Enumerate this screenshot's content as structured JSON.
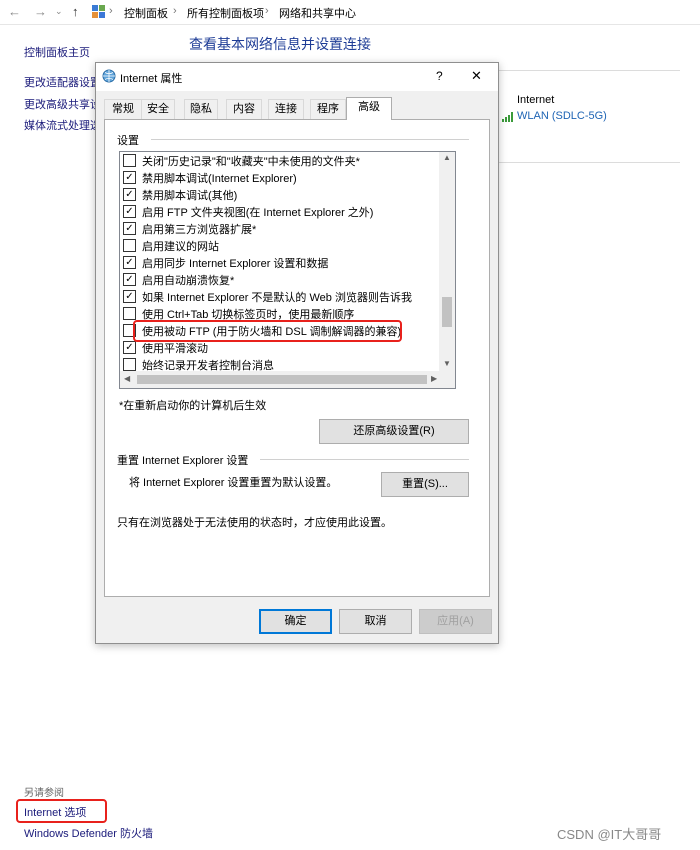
{
  "address_bar": {
    "crumbs": [
      "控制面板",
      "所有控制面板项",
      "网络和共享中心"
    ]
  },
  "control_panel": {
    "left_links": [
      "控制面板主页",
      "更改适配器设置",
      "更改高级共享设置",
      "媒体流式处理选项"
    ],
    "title": "查看基本网络信息并设置连接",
    "network_label": "Internet",
    "wlan_link": "WLAN (SDLC-5G)",
    "see_also": "另请参阅",
    "internet_options": "Internet 选项",
    "firewall": "Windows Defender 防火墙"
  },
  "dialog": {
    "title": "Internet 属性",
    "help": "?",
    "close": "✕",
    "tabs": [
      "常规",
      "安全",
      "隐私",
      "内容",
      "连接",
      "程序",
      "高级"
    ],
    "active_tab": "高级",
    "settings_label": "设置",
    "items": [
      {
        "label": "关闭\"历史记录\"和\"收藏夹\"中未使用的文件夹*",
        "checked": false
      },
      {
        "label": "禁用脚本调试(Internet Explorer)",
        "checked": true
      },
      {
        "label": "禁用脚本调试(其他)",
        "checked": true
      },
      {
        "label": "启用 FTP 文件夹视图(在 Internet Explorer 之外)",
        "checked": true
      },
      {
        "label": "启用第三方浏览器扩展*",
        "checked": true
      },
      {
        "label": "启用建议的网站",
        "checked": false
      },
      {
        "label": "启用同步 Internet Explorer 设置和数据",
        "checked": true
      },
      {
        "label": "启用自动崩溃恢复*",
        "checked": true
      },
      {
        "label": "如果 Internet Explorer 不是默认的 Web 浏览器则告诉我",
        "checked": true
      },
      {
        "label": "使用 Ctrl+Tab 切换标签页时，使用最新顺序",
        "checked": false
      },
      {
        "label": "使用被动 FTP (用于防火墙和 DSL 调制解调器的兼容)",
        "checked": false
      },
      {
        "label": "使用平滑滚动",
        "checked": true
      },
      {
        "label": "始终记录开发者控制台消息",
        "checked": false
      }
    ],
    "restart_note": "*在重新启动你的计算机后生效",
    "restore_btn": "还原高级设置(R)",
    "reset_section": "重置 Internet Explorer 设置",
    "reset_desc": "将 Internet Explorer 设置重置为默认设置。",
    "reset_btn": "重置(S)...",
    "reset_note": "只有在浏览器处于无法使用的状态时，才应使用此设置。",
    "ok": "确定",
    "cancel": "取消",
    "apply": "应用(A)"
  },
  "watermark": "CSDN @IT大哥哥",
  "colors": {
    "highlight": "#e8211c",
    "link": "#1a1a7a",
    "title": "#1e3c96",
    "wlan": "#1e64b4"
  }
}
